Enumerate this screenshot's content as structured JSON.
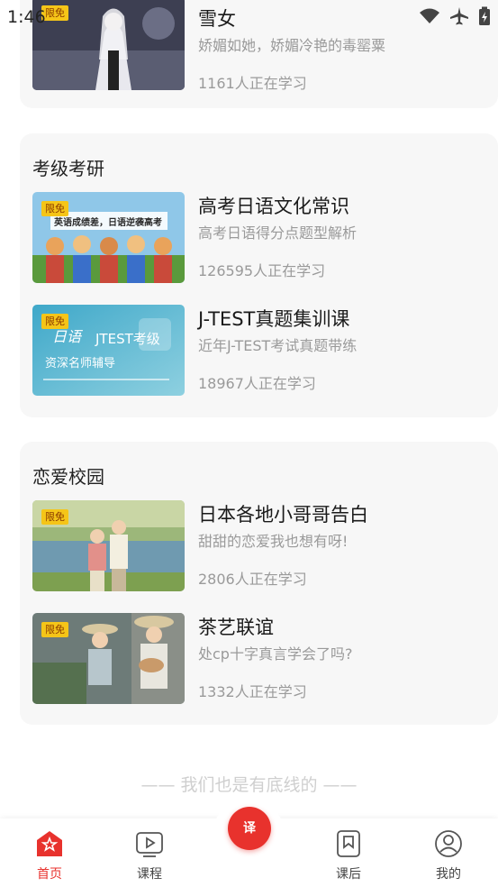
{
  "status_bar": {
    "time": "1:46"
  },
  "top_course": {
    "badge": "限免",
    "title": "雪女",
    "subtitle": "娇媚如她，娇媚冷艳的毒罂粟",
    "count": "1161人正在学习"
  },
  "sections": [
    {
      "title": "考级考研",
      "courses": [
        {
          "badge": "限免",
          "thumb_text": "英语成绩差，日语逆袭高考",
          "title": "高考日语文化常识",
          "subtitle": "高考日语得分点题型解析",
          "count": "126595人正在学习"
        },
        {
          "badge": "限免",
          "thumb_text": "日语",
          "thumb_text2": "JTEST考级",
          "thumb_text3": "资深名师辅导",
          "title": "J-TEST真题集训课",
          "subtitle": "近年J-TEST考试真题带练",
          "count": "18967人正在学习"
        }
      ]
    },
    {
      "title": "恋爱校园",
      "courses": [
        {
          "badge": "限免",
          "title": "日本各地小哥哥告白",
          "subtitle": "甜甜的恋爱我也想有呀!",
          "count": "2806人正在学习"
        },
        {
          "badge": "限免",
          "title": "茶艺联谊",
          "subtitle": "处cp十字真言学会了吗?",
          "count": "1332人正在学习"
        }
      ]
    }
  ],
  "footer_note": "—— 我们也是有底线的 ——",
  "tabbar": {
    "home": "首页",
    "course": "课程",
    "center": "译",
    "after_class": "课后",
    "mine": "我的"
  },
  "colors": {
    "accent": "#e8322d",
    "badge": "#f5c518"
  }
}
